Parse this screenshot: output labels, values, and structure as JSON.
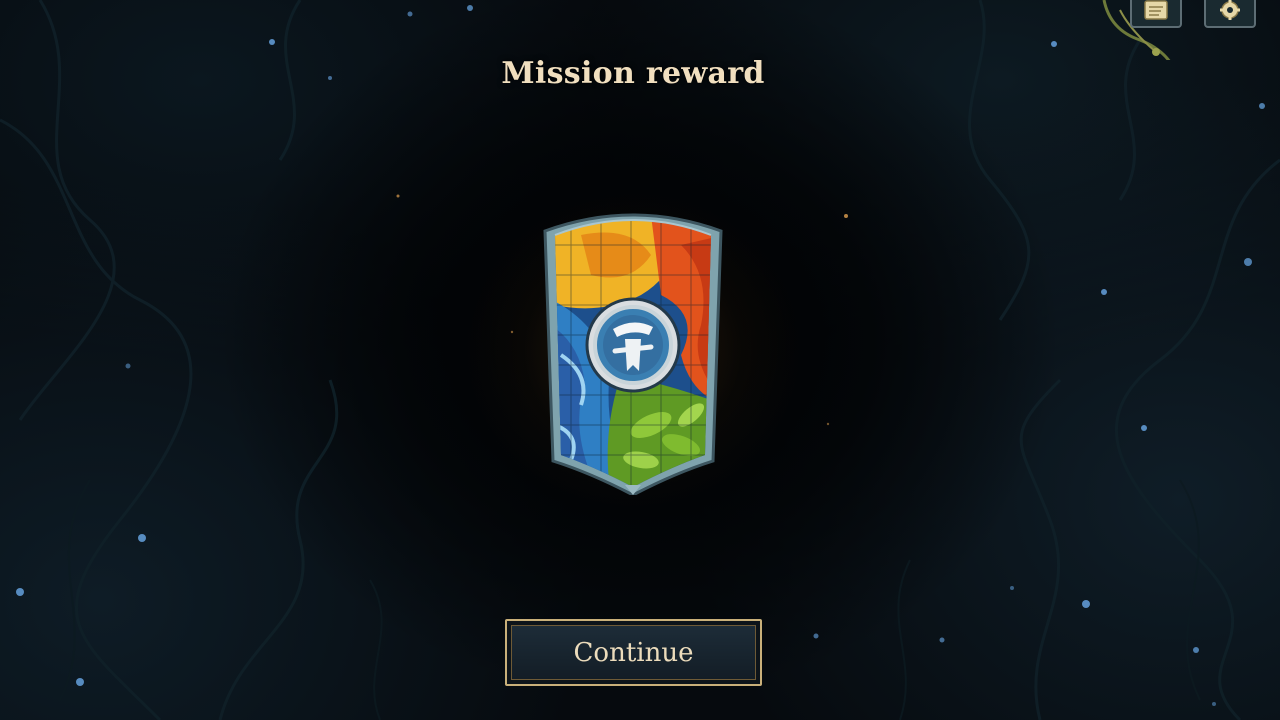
{
  "screen": {
    "title": "Mission reward",
    "continue_label": "Continue"
  },
  "reward": {
    "icon": "stained-glass-shield-icon",
    "colors": {
      "fire": "#e2531c",
      "sun": "#f0b326",
      "water": "#2f7fc4",
      "leaf": "#7fbb2f",
      "frame": "#7fa3ad"
    }
  },
  "corner": {
    "map_icon": "scroll-map-icon",
    "settings_icon": "gear-icon"
  },
  "theme": {
    "title_color": "#f1dfbf",
    "button_border": "#c9b07a",
    "button_bg": "#1b2834"
  }
}
